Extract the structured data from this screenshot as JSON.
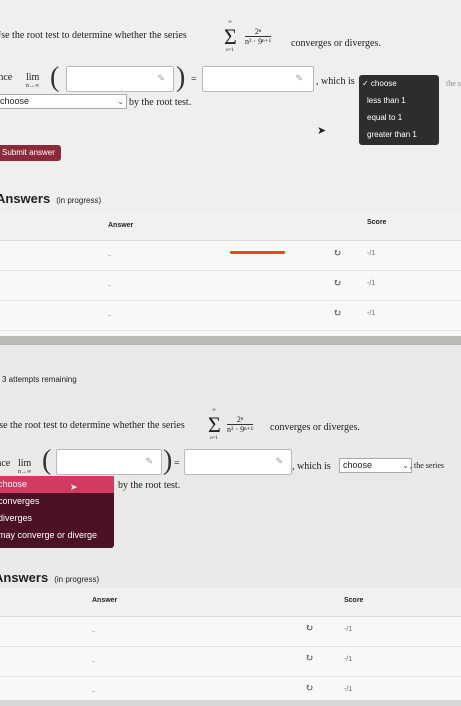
{
  "top": {
    "question_prefix": "Use the root test to determine whether the series",
    "question_suffix": "converges or diverges.",
    "sum_upper": "∞",
    "sum_lower": "n=1",
    "numerator": "2ⁿ",
    "denominator": "n³ · 9ⁿ⁺¹",
    "since_label": "Since",
    "lim_label": "lim",
    "lim_sub": "n→∞",
    "equals": "=",
    "which_is": ", which is",
    "the_series": "the se",
    "choose_select": "choose",
    "by_root_test": "by the root test.",
    "dropdown_options": [
      "✓ choose",
      "less than 1",
      "equal to 1",
      "greater than 1"
    ],
    "submit_label": "Submit answer",
    "answers_heading": "Answers",
    "answers_status": "(in progress)",
    "col_answer": "Answer",
    "col_score": "Score",
    "rows": [
      {
        "answer": "-",
        "score": "-/1"
      },
      {
        "answer": "-",
        "score": "-/1"
      },
      {
        "answer": "-",
        "score": "-/1"
      }
    ]
  },
  "bottom": {
    "attempts": "3 attempts remaining",
    "question_prefix": "Use the root test to determine whether the series",
    "question_suffix": "converges or diverges.",
    "sum_upper": "∞",
    "sum_lower": "n=1",
    "numerator": "2ⁿ",
    "denominator": "n³ · 9ⁿ⁺¹",
    "since_label": "Since",
    "lim_label": "lim",
    "lim_sub": "n→∞",
    "equals": "=",
    "which_is": ", which is",
    "choose_select": "choose",
    "the_series": ", the series",
    "by_root_test": "by the root test.",
    "dropdown_options": [
      "choose",
      "converges",
      "diverges",
      "may converge or diverge"
    ],
    "answers_heading": "Answers",
    "answers_status": "(in progress)",
    "col_answer": "Answer",
    "col_score": "Score",
    "rows": [
      {
        "answer": "-",
        "score": "-/1"
      },
      {
        "answer": "-",
        "score": "-/1"
      },
      {
        "answer": "-",
        "score": "-/1"
      }
    ]
  },
  "icons": {
    "pencil": "pencil-icon",
    "recheck": "refresh-icon",
    "chevron": "chevron-down-icon"
  },
  "colors": {
    "submit_button": "#8a2a3a",
    "dropdown_dark": "#2d2d2f",
    "dropdown_maroon": "#4a1222",
    "highlight": "#d33a62",
    "red_mark": "#e8412c"
  }
}
